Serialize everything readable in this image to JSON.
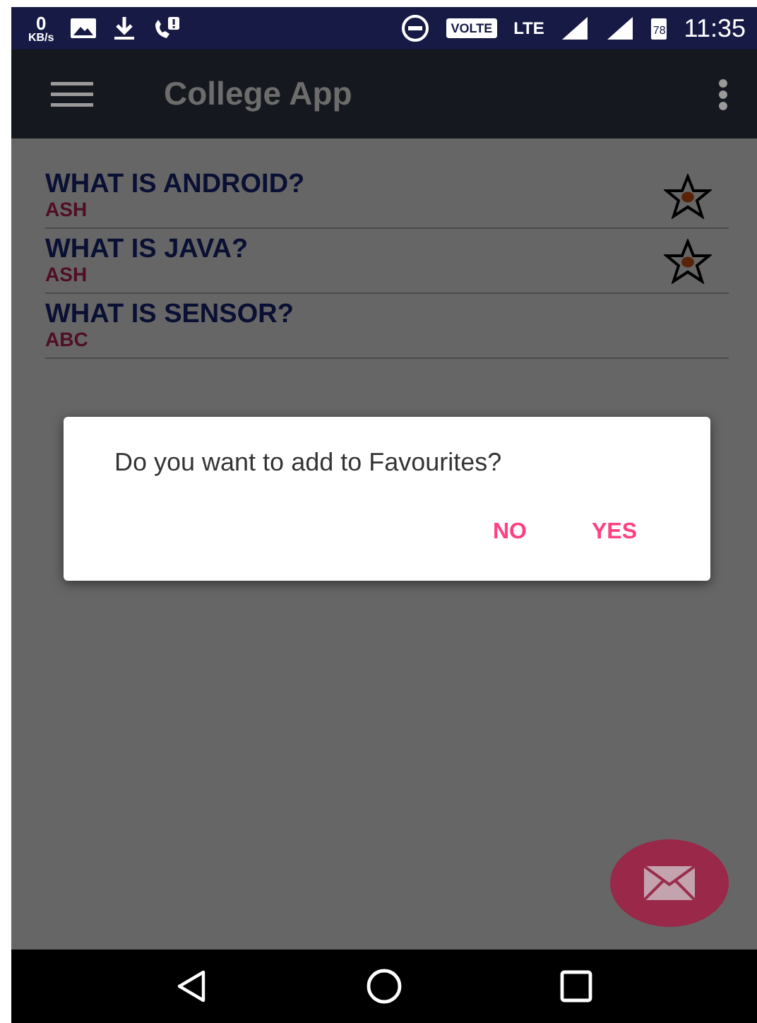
{
  "status_bar": {
    "speed": "0",
    "speed_unit": "KB/s",
    "volte": "VOLTE",
    "network": "LTE",
    "battery": "78",
    "time": "11:35"
  },
  "app_bar": {
    "title": "College App"
  },
  "questions": [
    {
      "title": "WHAT IS ANDROID?",
      "author": "ASH",
      "favourite": true
    },
    {
      "title": "WHAT IS JAVA?",
      "author": "ASH",
      "favourite": true
    },
    {
      "title": "WHAT IS SENSOR?",
      "author": "ABC",
      "favourite": false
    }
  ],
  "dialog": {
    "message": "Do you want to add to Favourites?",
    "buttons": [
      "NO",
      "YES"
    ]
  }
}
